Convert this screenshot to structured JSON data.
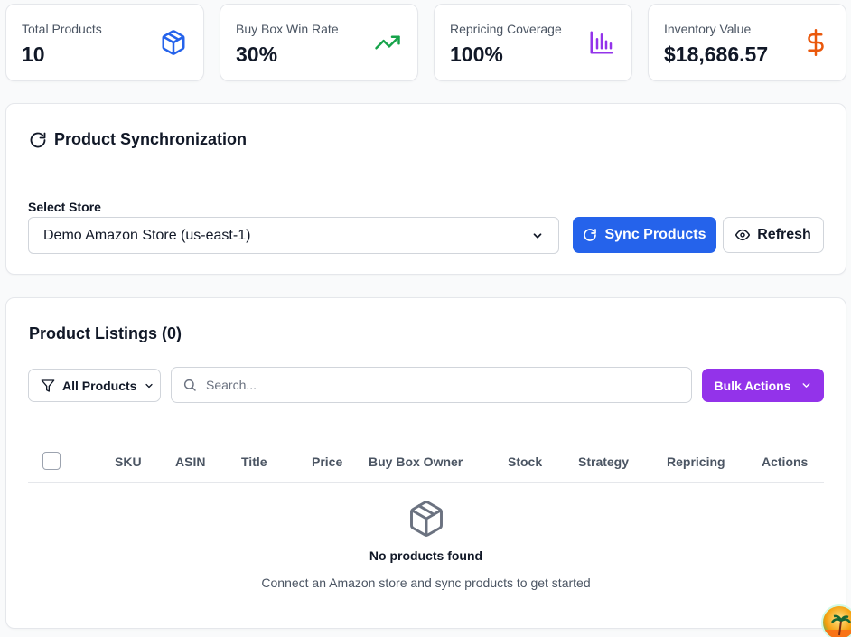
{
  "stats": [
    {
      "label": "Total Products",
      "value": "10",
      "icon": "cube-icon",
      "color": "#2563eb"
    },
    {
      "label": "Buy Box Win Rate",
      "value": "30%",
      "icon": "trending-up-icon",
      "color": "#16a34a"
    },
    {
      "label": "Repricing Coverage",
      "value": "100%",
      "icon": "bar-chart-icon",
      "color": "#9333ea"
    },
    {
      "label": "Inventory Value",
      "value": "$18,686.57",
      "icon": "dollar-icon",
      "color": "#ea580c"
    }
  ],
  "sync": {
    "title": "Product Synchronization",
    "select_label": "Select Store",
    "selected_store": "Demo Amazon Store (us-east-1)",
    "sync_button": "Sync Products",
    "refresh_button": "Refresh"
  },
  "listings": {
    "title": "Product Listings (0)",
    "filter_label": "All Products",
    "search_placeholder": "Search...",
    "bulk_label": "Bulk Actions",
    "columns": [
      "SKU",
      "ASIN",
      "Title",
      "Price",
      "Buy Box Owner",
      "Stock",
      "Strategy",
      "Repricing",
      "Actions"
    ],
    "empty_title": "No products found",
    "empty_subtitle": "Connect an Amazon store and sync products to get started"
  },
  "colors": {
    "primary": "#2563eb",
    "accent": "#9333ea"
  }
}
